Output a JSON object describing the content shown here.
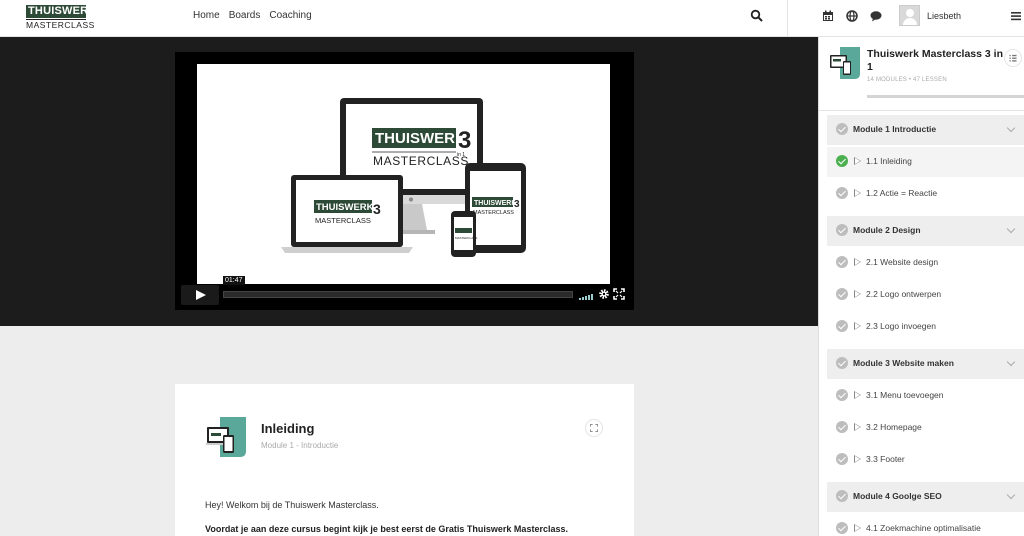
{
  "header": {
    "logo_top": "THUISWERK",
    "logo_bottom": "MASTERCLASS",
    "nav": [
      "Home",
      "Boards",
      "Coaching"
    ],
    "user_name": "Liesbeth",
    "icons": [
      "search-icon",
      "calendar-icon",
      "globe-icon",
      "chat-icon",
      "hamburger-icon"
    ]
  },
  "video": {
    "time": "01:47",
    "progress": 0.0,
    "brand_line1": "THUISWERK",
    "brand_number": "3",
    "brand_small": "in 1",
    "brand_line2": "MASTERCLASS"
  },
  "lesson": {
    "title": "Inleiding",
    "subtitle": "Module 1 - Introductie",
    "paragraph1": "Hey! Welkom bij de Thuiswerk Masterclass.",
    "paragraph2": "Voordat je aan deze cursus begint kijk je best eerst de Gratis Thuiswerk Masterclass."
  },
  "course": {
    "title": "Thuiswerk Masterclass 3 in 1",
    "meta": "14 MODULES  •  47 LESSEN",
    "items": [
      {
        "type": "module",
        "label": "Module 1   Introductie"
      },
      {
        "type": "lesson",
        "label": "1.1 Inleiding",
        "done": true
      },
      {
        "type": "lesson",
        "label": "1.2 Actie = Reactie",
        "done": false
      },
      {
        "type": "module",
        "label": "Module 2   Design"
      },
      {
        "type": "lesson",
        "label": "2.1 Website design",
        "done": false
      },
      {
        "type": "lesson",
        "label": "2.2 Logo ontwerpen",
        "done": false
      },
      {
        "type": "lesson",
        "label": "2.3 Logo invoegen",
        "done": false
      },
      {
        "type": "module",
        "label": "Module 3   Website maken"
      },
      {
        "type": "lesson",
        "label": "3.1 Menu toevoegen",
        "done": false
      },
      {
        "type": "lesson",
        "label": "3.2 Homepage",
        "done": false
      },
      {
        "type": "lesson",
        "label": "3.3 Footer",
        "done": false
      },
      {
        "type": "module",
        "label": "Module 4   Goolge SEO"
      },
      {
        "type": "lesson",
        "label": "4.1 Zoekmachine optimalisatie",
        "done": false
      }
    ]
  },
  "colors": {
    "brand_green": "#2d4a36",
    "check_done": "#4caf50",
    "teal_accent": "#5aa89a"
  }
}
